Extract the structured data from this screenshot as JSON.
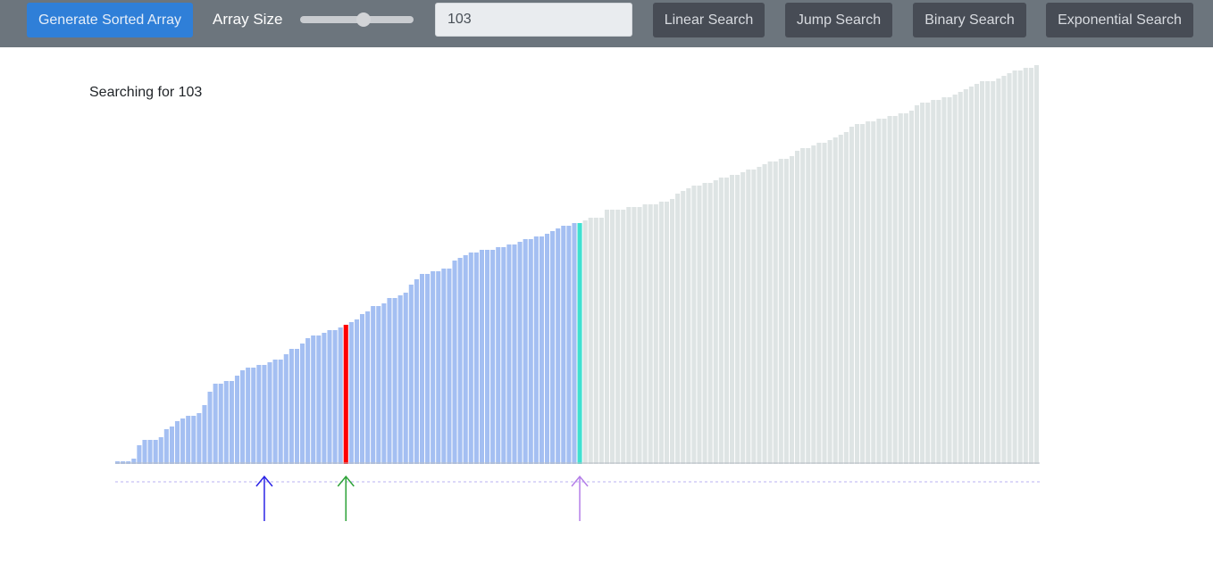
{
  "toolbar": {
    "generate_label": "Generate Sorted Array",
    "array_size_label": "Array Size",
    "array_size_value": 0.56,
    "search_value": "103",
    "linear_label": "Linear Search",
    "jump_label": "Jump Search",
    "binary_label": "Binary Search",
    "exponential_label": "Exponential Search"
  },
  "status_text": "Searching for 103",
  "colors": {
    "toolbar_bg": "#6c757d",
    "active_range": "#a4bff2",
    "inactive": "#dee4e4",
    "current": "#ff0000",
    "found": "#40e0d0",
    "pointer_low": "#2a23e6",
    "pointer_mid": "#2ea339",
    "pointer_high": "#b47ee8"
  },
  "icons": {
    "pointer": "up-arrow-icon"
  },
  "array": {
    "values": [
      1,
      1,
      1,
      2,
      7,
      9,
      9,
      9,
      10,
      13,
      14,
      16,
      17,
      18,
      18,
      19,
      22,
      27,
      30,
      30,
      31,
      31,
      33,
      35,
      36,
      36,
      37,
      37,
      38,
      39,
      39,
      41,
      43,
      43,
      45,
      47,
      48,
      48,
      49,
      50,
      50,
      51,
      52,
      53,
      54,
      56,
      57,
      59,
      59,
      60,
      62,
      62,
      63,
      64,
      67,
      69,
      71,
      71,
      72,
      72,
      73,
      73,
      76,
      77,
      78,
      79,
      79,
      80,
      80,
      80,
      81,
      81,
      82,
      82,
      83,
      84,
      84,
      85,
      85,
      86,
      87,
      88,
      89,
      89,
      90,
      90,
      91,
      92,
      92,
      92,
      95,
      95,
      95,
      95,
      96,
      96,
      96,
      97,
      97,
      97,
      98,
      98,
      99,
      101,
      102,
      103,
      104,
      104,
      105,
      105,
      106,
      107,
      107,
      108,
      108,
      109,
      110,
      110,
      111,
      112,
      113,
      113,
      114,
      114,
      115,
      117,
      118,
      118,
      119,
      120,
      120,
      121,
      122,
      123,
      124,
      126,
      127,
      127,
      128,
      128,
      129,
      129,
      130,
      130,
      131,
      131,
      132,
      134,
      135,
      135,
      136,
      136,
      137,
      137,
      138,
      139,
      140,
      141,
      142,
      143,
      143,
      143,
      144,
      145,
      146,
      147,
      147,
      148,
      148,
      149
    ],
    "low_index": 27,
    "mid_index": 42,
    "high_index": 85,
    "found_index": 85
  }
}
